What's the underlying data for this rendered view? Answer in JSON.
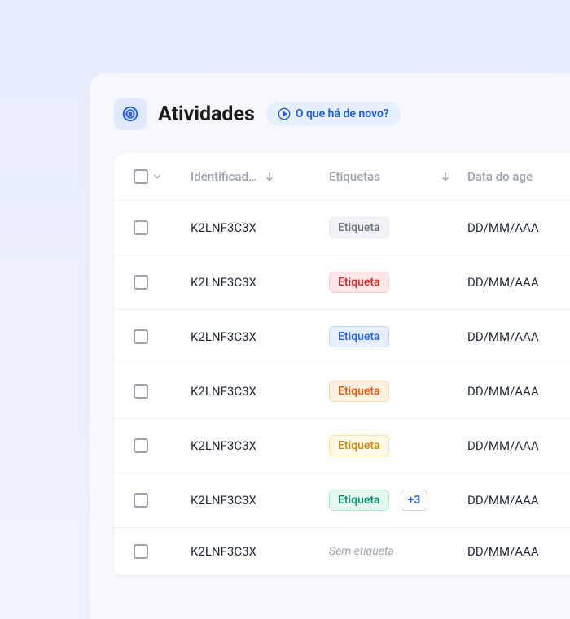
{
  "header": {
    "title": "Atividades",
    "whats_new": "O que há de novo?"
  },
  "columns": {
    "identifier": "Identificad…",
    "tags": "Etiquetas",
    "date": "Data do age"
  },
  "rows": [
    {
      "id": "K2LNF3C3X",
      "tag": "Etiqueta",
      "tag_color": "gray",
      "extra": null,
      "no_tag": false,
      "date": "DD/MM/AAA"
    },
    {
      "id": "K2LNF3C3X",
      "tag": "Etiqueta",
      "tag_color": "red",
      "extra": null,
      "no_tag": false,
      "date": "DD/MM/AAA"
    },
    {
      "id": "K2LNF3C3X",
      "tag": "Etiqueta",
      "tag_color": "blue",
      "extra": null,
      "no_tag": false,
      "date": "DD/MM/AAA"
    },
    {
      "id": "K2LNF3C3X",
      "tag": "Etiqueta",
      "tag_color": "orange",
      "extra": null,
      "no_tag": false,
      "date": "DD/MM/AAA"
    },
    {
      "id": "K2LNF3C3X",
      "tag": "Etiqueta",
      "tag_color": "yellow",
      "extra": null,
      "no_tag": false,
      "date": "DD/MM/AAA"
    },
    {
      "id": "K2LNF3C3X",
      "tag": "Etiqueta",
      "tag_color": "green",
      "extra": "+3",
      "no_tag": false,
      "date": "DD/MM/AAA"
    },
    {
      "id": "K2LNF3C3X",
      "tag": null,
      "tag_color": null,
      "extra": null,
      "no_tag": true,
      "no_tag_label": "Sem etiqueta",
      "date": "DD/MM/AAA"
    }
  ]
}
